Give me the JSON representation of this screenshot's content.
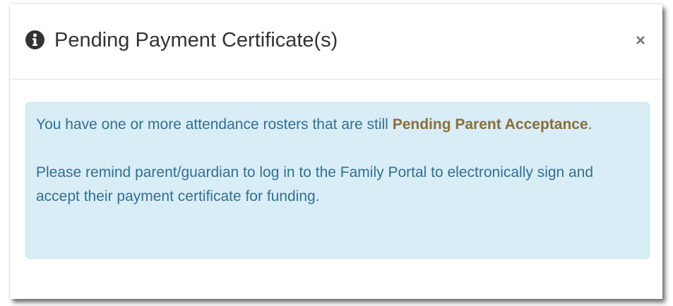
{
  "modal": {
    "title": "Pending Payment Certificate(s)",
    "info_icon": "info-circle-icon",
    "close_icon": "close-icon",
    "close_glyph": "×"
  },
  "alert": {
    "paragraph1_prefix": "You have one or more attendance rosters that are still ",
    "paragraph1_strong": "Pending Parent Acceptance",
    "paragraph1_suffix": ".",
    "paragraph2": "Please remind parent/guardian to log in to the Family Portal to electronically sign and accept their payment certificate for funding."
  },
  "colors": {
    "alert_background": "#d9edf7",
    "alert_border": "#bce8f1",
    "alert_text": "#31708f",
    "highlight_text": "#8a6d3b",
    "title_text": "#333333"
  }
}
